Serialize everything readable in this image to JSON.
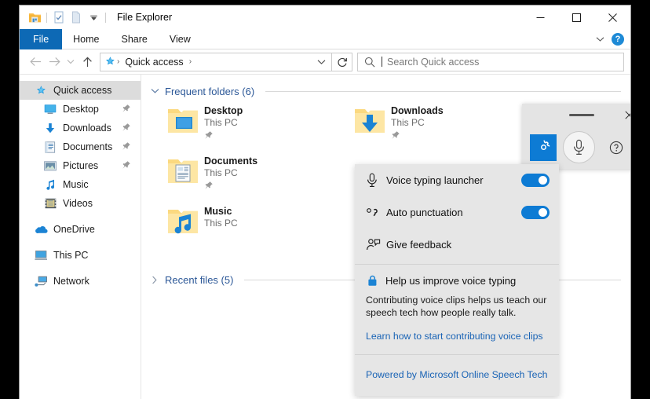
{
  "window": {
    "title": "File Explorer",
    "controls": {
      "minimize": "minimize-button",
      "maximize": "maximize-button",
      "close": "close-button"
    }
  },
  "quick_access_toolbar": {
    "items": [
      {
        "name": "explorer-icon",
        "tooltip": "File Explorer"
      },
      {
        "name": "properties-icon",
        "tooltip": "Properties"
      },
      {
        "name": "new-folder-icon",
        "tooltip": "New folder"
      },
      {
        "name": "customize-chevron-icon",
        "tooltip": "Customize Quick Access Toolbar"
      }
    ]
  },
  "ribbon": {
    "tabs": [
      {
        "label": "File",
        "active": true
      },
      {
        "label": "Home",
        "active": false
      },
      {
        "label": "Share",
        "active": false
      },
      {
        "label": "View",
        "active": false
      }
    ],
    "expand_icon": "chevron-down-icon",
    "help_label": "?"
  },
  "navigation": {
    "back": "back-arrow-icon",
    "forward": "forward-arrow-icon",
    "recent": "recent-locations-chevron-icon",
    "up": "up-arrow-icon",
    "address": {
      "icon": "quick-access-star-icon",
      "crumbs": [
        "Quick access"
      ],
      "separator": "›",
      "dropdown_icon": "chevron-down-icon"
    },
    "refresh_icon": "refresh-icon"
  },
  "search": {
    "placeholder": "Search Quick access",
    "icon": "search-icon",
    "value": ""
  },
  "sidebar": {
    "items": [
      {
        "label": "Quick access",
        "icon": "quick-access-star-icon",
        "selected": true,
        "child": false,
        "pinned": false
      },
      {
        "label": "Desktop",
        "icon": "desktop-icon",
        "selected": false,
        "child": true,
        "pinned": true
      },
      {
        "label": "Downloads",
        "icon": "downloads-icon",
        "selected": false,
        "child": true,
        "pinned": true
      },
      {
        "label": "Documents",
        "icon": "documents-icon",
        "selected": false,
        "child": true,
        "pinned": true
      },
      {
        "label": "Pictures",
        "icon": "pictures-icon",
        "selected": false,
        "child": true,
        "pinned": true
      },
      {
        "label": "Music",
        "icon": "music-icon",
        "selected": false,
        "child": true,
        "pinned": false
      },
      {
        "label": "Videos",
        "icon": "videos-icon",
        "selected": false,
        "child": true,
        "pinned": false
      },
      {
        "label": "OneDrive",
        "icon": "onedrive-cloud-icon",
        "selected": false,
        "child": false,
        "pinned": false,
        "gap_before": true
      },
      {
        "label": "This PC",
        "icon": "this-pc-icon",
        "selected": false,
        "child": false,
        "pinned": false,
        "gap_before": true
      },
      {
        "label": "Network",
        "icon": "network-icon",
        "selected": false,
        "child": false,
        "pinned": false,
        "gap_before": true
      }
    ]
  },
  "content": {
    "frequent_folders": {
      "title": "Frequent folders (6)",
      "expanded": true,
      "chevron": "chevron-down-icon",
      "tiles": [
        {
          "name": "Desktop",
          "location": "This PC",
          "icon": "folder-desktop-icon",
          "pinned": true
        },
        {
          "name": "Downloads",
          "location": "This PC",
          "icon": "folder-downloads-icon",
          "pinned": true
        },
        {
          "name": "Documents",
          "location": "This PC",
          "icon": "folder-documents-icon",
          "pinned": true
        },
        {
          "name": "",
          "location": "",
          "icon": "",
          "pinned": false
        },
        {
          "name": "Music",
          "location": "This PC",
          "icon": "folder-music-icon",
          "pinned": false
        }
      ]
    },
    "recent_files": {
      "title": "Recent files (5)",
      "expanded": false,
      "chevron": "chevron-right-icon"
    }
  },
  "voice_toolbar": {
    "grip": "drag-handle-icon",
    "close": "close-icon",
    "settings_icon": "gear-icon",
    "mic_icon": "microphone-icon",
    "help_icon": "help-circle-icon",
    "accent": "#0d7bd4"
  },
  "voice_settings": {
    "items": [
      {
        "label": "Voice typing launcher",
        "icon": "microphone-icon",
        "has_toggle": true,
        "toggle_on": true
      },
      {
        "label": "Auto punctuation",
        "icon": "auto-punctuation-icon",
        "has_toggle": true,
        "toggle_on": true
      },
      {
        "label": "Give feedback",
        "icon": "feedback-person-icon",
        "has_toggle": false,
        "toggle_on": false
      }
    ],
    "privacy": {
      "icon": "lock-icon",
      "title": "Help us improve voice typing",
      "body": "Contributing voice clips helps us teach our speech tech how people really talk.",
      "link": "Learn how to start contributing voice clips"
    },
    "footer_link": "Powered by Microsoft Online Speech Tech",
    "accent": "#0d7bd4",
    "link_color": "#1963b5"
  }
}
